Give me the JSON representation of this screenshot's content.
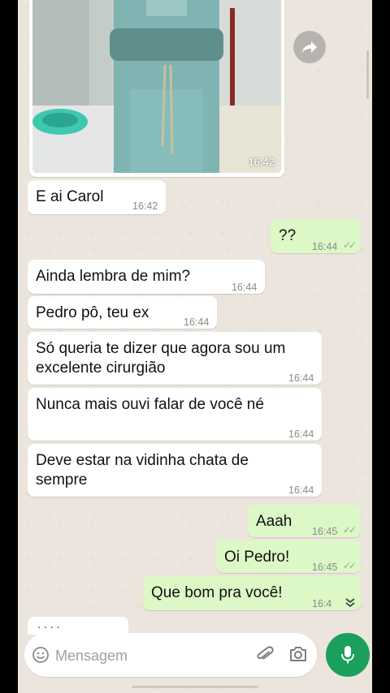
{
  "chat": {
    "photo_time": "16:42",
    "messages": [
      {
        "text": "E ai Carol",
        "time": "16:42",
        "dir": "in"
      },
      {
        "text": "??",
        "time": "16:44",
        "dir": "out"
      },
      {
        "text": "Ainda lembra de mim?",
        "time": "16:44",
        "dir": "in"
      },
      {
        "text": "Pedro pô, teu ex",
        "time": "16:44",
        "dir": "in"
      },
      {
        "text_line1": "Só queria te dizer que agora sou um",
        "text_line2": "excelente cirurgião",
        "time": "16:44",
        "dir": "in"
      },
      {
        "text": "Nunca mais ouvi falar de você né",
        "time": "16:44",
        "dir": "in"
      },
      {
        "text_line1": "Deve estar na vidinha chata de",
        "text_line2": "sempre",
        "time": "16:44",
        "dir": "in"
      },
      {
        "text": "Aaah",
        "time": "16:45",
        "dir": "out"
      },
      {
        "text": "Oi Pedro!",
        "time": "16:45",
        "dir": "out"
      },
      {
        "text": "Que bom pra você!",
        "time": "16:4",
        "dir": "out"
      }
    ],
    "typing": "...."
  },
  "composer": {
    "placeholder": "Mensagem"
  },
  "colors": {
    "background": "#ece5dd",
    "incoming": "#ffffff",
    "outgoing": "#dcf8c6",
    "mic": "#1aa05c"
  },
  "icons": [
    "forward-icon",
    "double-check-icon",
    "chevron-down-icon",
    "emoji-icon",
    "paperclip-icon",
    "camera-icon",
    "mic-icon"
  ]
}
